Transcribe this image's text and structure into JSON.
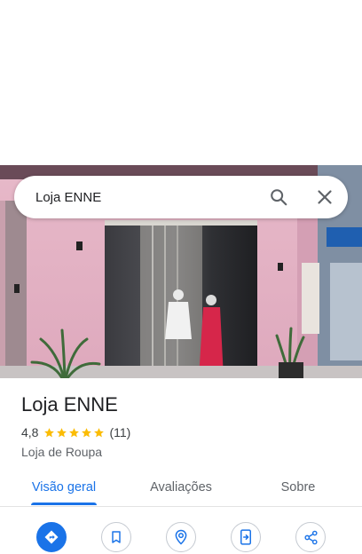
{
  "search": {
    "query": "Loja ENNE"
  },
  "icons": {
    "search": "search-icon",
    "close": "close-icon",
    "directions": "directions-icon",
    "save": "bookmark-icon",
    "nearby": "nearby-icon",
    "send": "send-to-phone-icon",
    "share": "share-icon"
  },
  "place": {
    "title": "Loja ENNE",
    "rating": "4,8",
    "stars": 5,
    "reviews": "(11)",
    "category": "Loja de Roupa"
  },
  "tabs": [
    {
      "label": "Visão geral",
      "active": true
    },
    {
      "label": "Avaliações",
      "active": false
    },
    {
      "label": "Sobre",
      "active": false
    }
  ],
  "colors": {
    "accent": "#1a73e8",
    "star": "#fbbc04",
    "text": "#202124",
    "secondary": "#5f6368"
  }
}
